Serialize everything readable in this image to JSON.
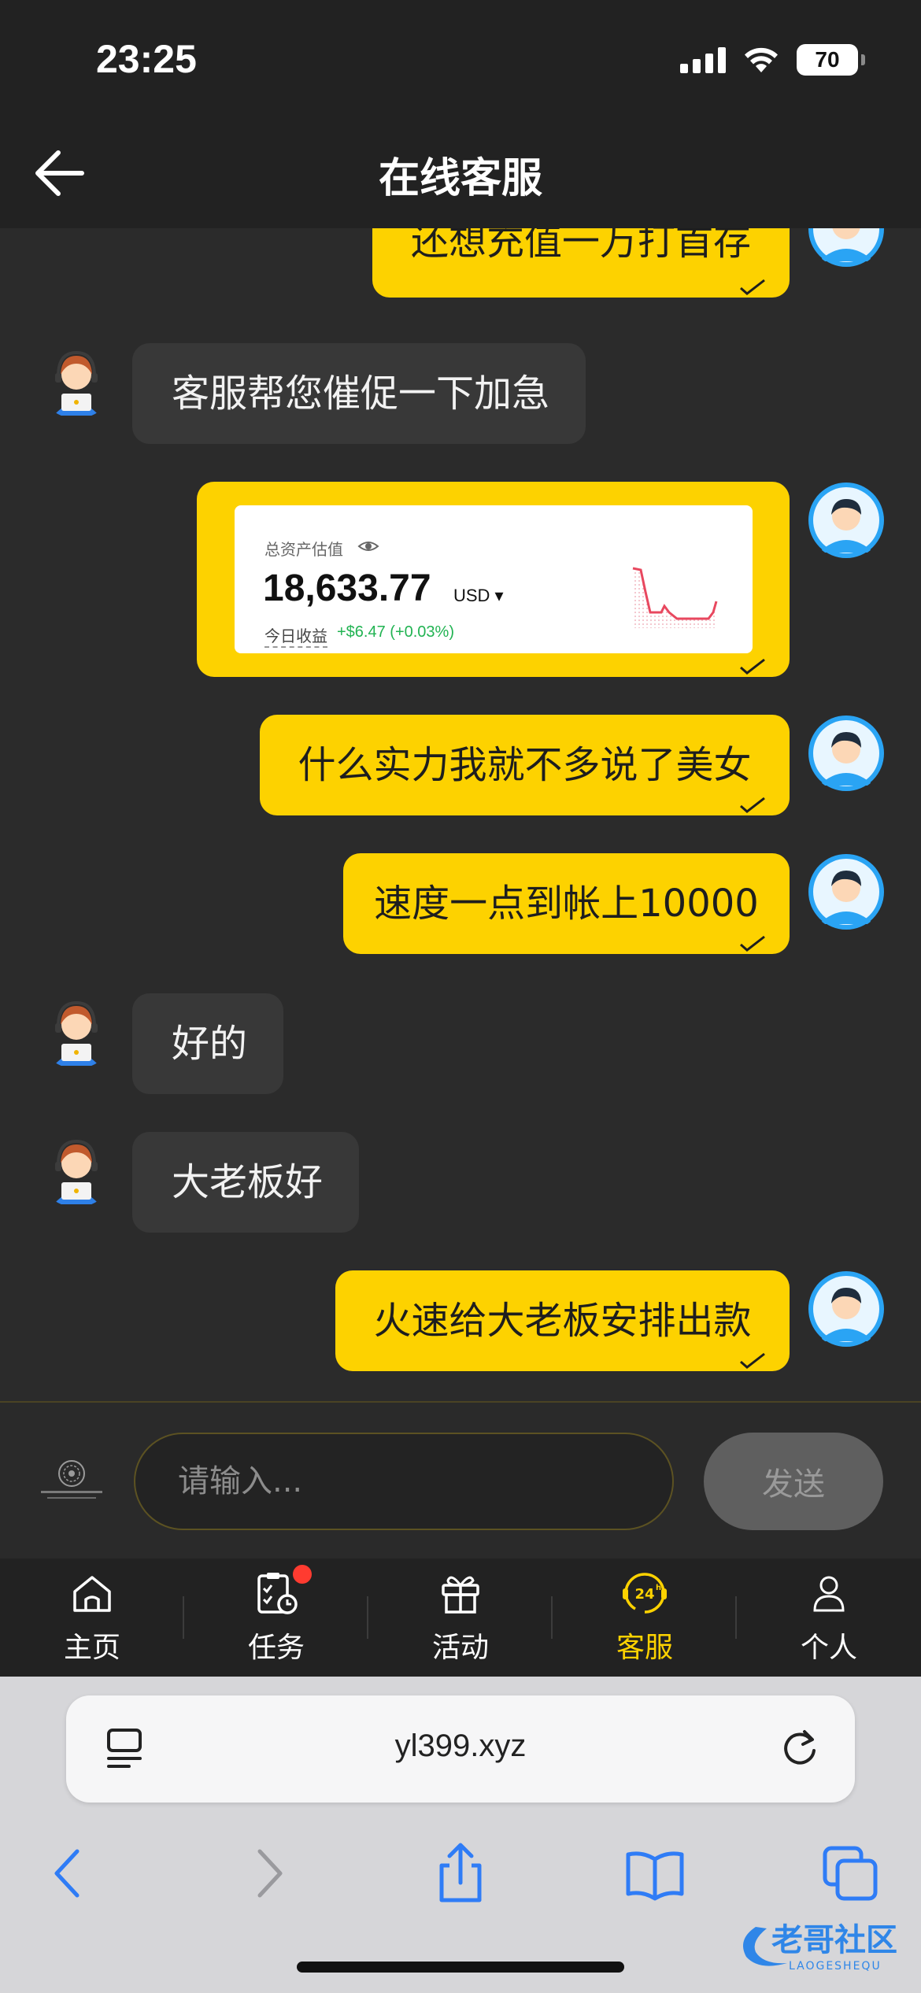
{
  "status": {
    "time": "23:25",
    "battery": "70"
  },
  "header": {
    "title": "在线客服"
  },
  "messages": [
    {
      "from": "me",
      "text": "还想充值一万打首存"
    },
    {
      "from": "agent",
      "text": "客服帮您催促一下加急"
    },
    {
      "from": "me",
      "type": "image-card"
    },
    {
      "from": "me",
      "text": "什么实力我就不多说了美女"
    },
    {
      "from": "me",
      "text": "速度一点到帐上10000"
    },
    {
      "from": "agent",
      "text": "好的"
    },
    {
      "from": "agent",
      "text": "大老板好"
    },
    {
      "from": "me",
      "text": "火速给大老板安排出款"
    }
  ],
  "asset_card": {
    "label": "总资产估值",
    "value": "18,633.77",
    "unit": "USD ▾",
    "income_label": "今日收益",
    "income_value": "+$6.47 (+0.03%)",
    "income_color": "#21b352",
    "sparkline_color": "#e8485f"
  },
  "input": {
    "placeholder": "请输入...",
    "send_label": "发送"
  },
  "tabs": [
    {
      "label": "主页",
      "icon": "home-icon"
    },
    {
      "label": "任务",
      "icon": "task-icon",
      "badge": true
    },
    {
      "label": "活动",
      "icon": "gift-icon"
    },
    {
      "label": "客服",
      "icon": "support-24h-icon",
      "active": true
    },
    {
      "label": "个人",
      "icon": "profile-icon"
    }
  ],
  "browser": {
    "url": "yl399.xyz"
  },
  "watermark": {
    "text": "老哥社区",
    "subtext": "LAOGESHEQU"
  },
  "colors": {
    "accent": "#fdd200",
    "background": "#2b2b2b",
    "agent_bubble": "#383838",
    "ios_blue": "#2f7cf6"
  }
}
